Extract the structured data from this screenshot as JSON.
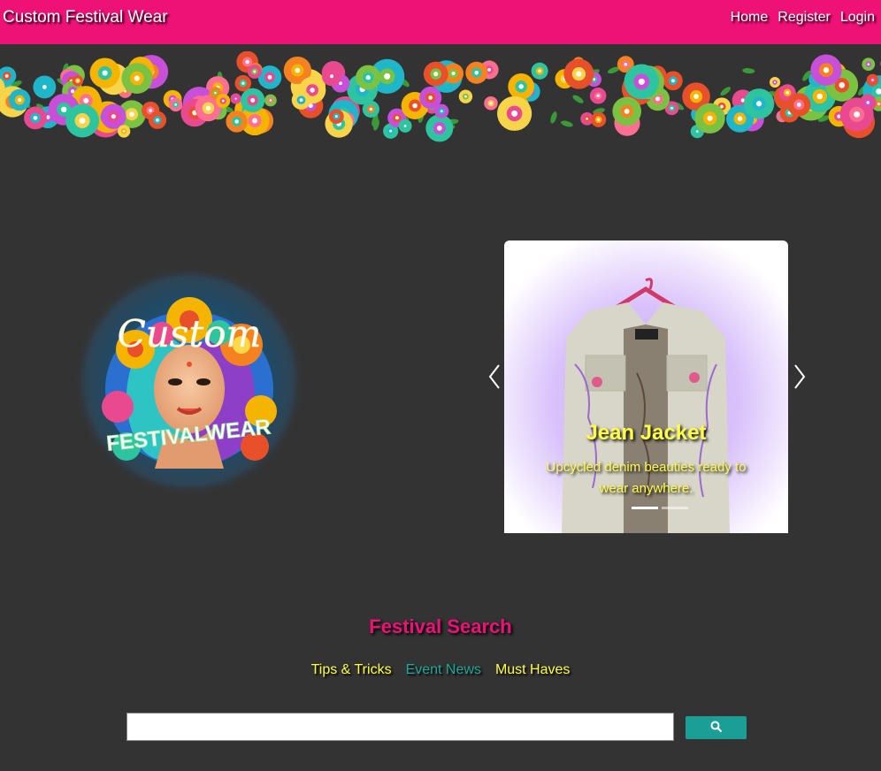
{
  "navbar": {
    "brand": "Custom Festival Wear",
    "links": [
      {
        "label": "Home"
      },
      {
        "label": "Register"
      },
      {
        "label": "Login"
      }
    ]
  },
  "carousel": {
    "active_slide": {
      "title": "Jean Jacket",
      "caption": "Upcycled denim beauties ready to wear anywhere."
    },
    "slide_count": 2,
    "active_index": 0
  },
  "search": {
    "title": "Festival Search",
    "tabs": [
      {
        "label": "Tips & Tricks"
      },
      {
        "label": "Event News"
      },
      {
        "label": "Must Haves"
      }
    ],
    "active_tab_index": 1,
    "input_value": "",
    "button_icon": "search-icon"
  },
  "colors": {
    "navbar_pink": "#ee1176",
    "background": "#333333",
    "caption_yellow": "#ffff44",
    "active_tab_teal": "#1fa89a",
    "search_button_teal": "#1b9e96"
  }
}
